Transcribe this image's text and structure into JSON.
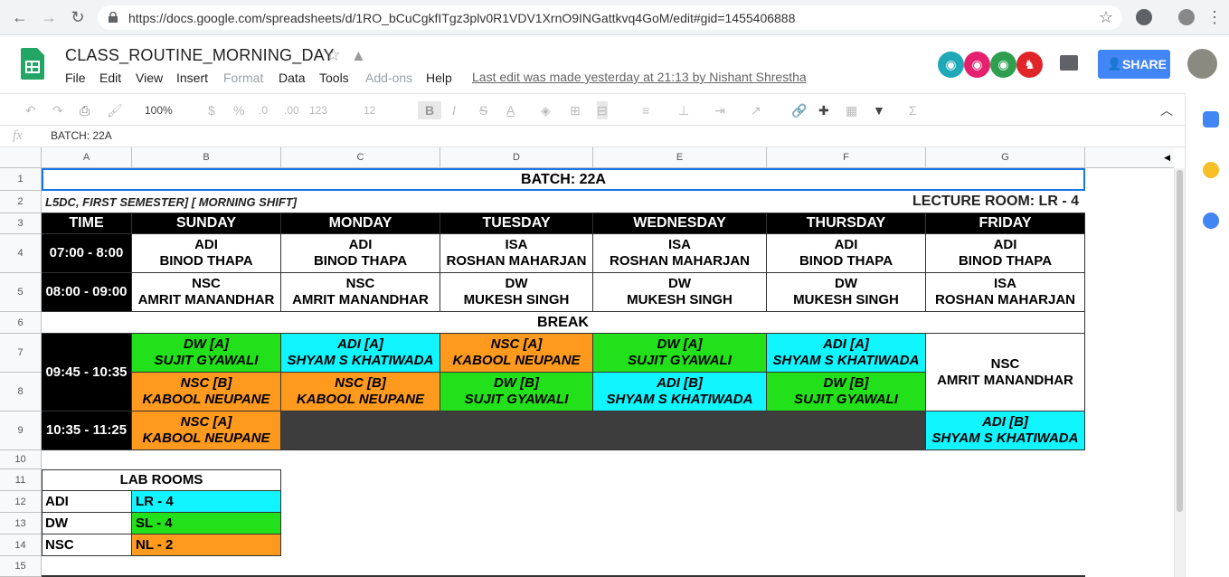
{
  "browser": {
    "url": "https://docs.google.com/spreadsheets/d/1RO_bCuCgkfITgz3plv0R1VDV1XrnO9INGattkvq4GoM/edit#gid=1455406888"
  },
  "doc": {
    "title": "CLASS_ROUTINE_MORNING_DAY",
    "menus": [
      "File",
      "Edit",
      "View",
      "Insert",
      "Format",
      "Data",
      "Tools",
      "Add-ons",
      "Help"
    ],
    "last_edit": "Last edit was made yesterday at 21:13 by Nishant Shrestha",
    "share_label": "SHARE"
  },
  "toolbar": {
    "zoom": "100%",
    "currency": "$",
    "percent": "%",
    "dec_less": ".0",
    "dec_more": ".00",
    "format_more": "123",
    "font_size": "12",
    "bold": "B",
    "italic": "I",
    "strike": "S",
    "text_color": "A"
  },
  "formula_bar": {
    "fx": "fx",
    "value": "BATCH: 22A"
  },
  "columns": [
    "A",
    "B",
    "C",
    "D",
    "E",
    "F",
    "G"
  ],
  "rows": [
    "1",
    "2",
    "3",
    "4",
    "5",
    "6",
    "7",
    "8",
    "9",
    "10",
    "11",
    "12",
    "13",
    "14",
    "15"
  ],
  "sheet": {
    "batch": "BATCH: 22A",
    "semester": "L5DC, FIRST SEMESTER] [ MORNING SHIFT]",
    "lecture_room": "LECTURE ROOM: LR - 4",
    "headers": [
      "TIME",
      "SUNDAY",
      "MONDAY",
      "TUESDAY",
      "WEDNESDAY",
      "THURSDAY",
      "FRIDAY"
    ],
    "r4": {
      "time": "07:00 - 8:00",
      "cells": [
        [
          "ADI",
          "BINOD THAPA"
        ],
        [
          "ADI",
          "BINOD THAPA"
        ],
        [
          "ISA",
          "ROSHAN MAHARJAN"
        ],
        [
          "ISA",
          "ROSHAN MAHARJAN"
        ],
        [
          "ADI",
          "BINOD THAPA"
        ],
        [
          "ADI",
          "BINOD THAPA"
        ]
      ]
    },
    "r5": {
      "time": "08:00 - 09:00",
      "cells": [
        [
          "NSC",
          "AMRIT MANANDHAR"
        ],
        [
          "NSC",
          "AMRIT MANANDHAR"
        ],
        [
          "DW",
          "MUKESH SINGH"
        ],
        [
          "DW",
          "MUKESH SINGH"
        ],
        [
          "DW",
          "MUKESH SINGH"
        ],
        [
          "ISA",
          "ROSHAN MAHARJAN"
        ]
      ]
    },
    "break": "BREAK",
    "r7": {
      "time": "09:45 - 10:35",
      "cells": [
        [
          "DW [A]",
          "SUJIT GYAWALI"
        ],
        [
          "ADI [A]",
          "SHYAM S KHATIWADA"
        ],
        [
          "NSC [A]",
          "KABOOL NEUPANE"
        ],
        [
          "DW [A]",
          "SUJIT GYAWALI"
        ],
        [
          "ADI [A]",
          "SHYAM S KHATIWADA"
        ]
      ],
      "friday": [
        "NSC",
        "AMRIT MANANDHAR"
      ]
    },
    "r8": {
      "cells": [
        [
          "NSC [B]",
          "KABOOL NEUPANE"
        ],
        [
          "NSC [B]",
          "KABOOL NEUPANE"
        ],
        [
          "DW [B]",
          "SUJIT GYAWALI"
        ],
        [
          "ADI [B]",
          "SHYAM S KHATIWADA"
        ],
        [
          "DW [B]",
          "SUJIT GYAWALI"
        ]
      ]
    },
    "r9": {
      "time": "10:35 - 11:25",
      "sunday": [
        "NSC [A]",
        "KABOOL NEUPANE"
      ],
      "friday": [
        "ADI [B]",
        "SHYAM S KHATIWADA"
      ]
    },
    "lab": {
      "title": "LAB ROOMS",
      "rows": [
        [
          "ADI",
          "LR - 4"
        ],
        [
          "DW",
          "SL - 4"
        ],
        [
          "NSC",
          "NL - 2"
        ]
      ]
    }
  },
  "colors": {
    "orange": "#ff9a1f",
    "green": "#22e11a",
    "cyan": "#10f5ff",
    "share": "#4285f4"
  }
}
